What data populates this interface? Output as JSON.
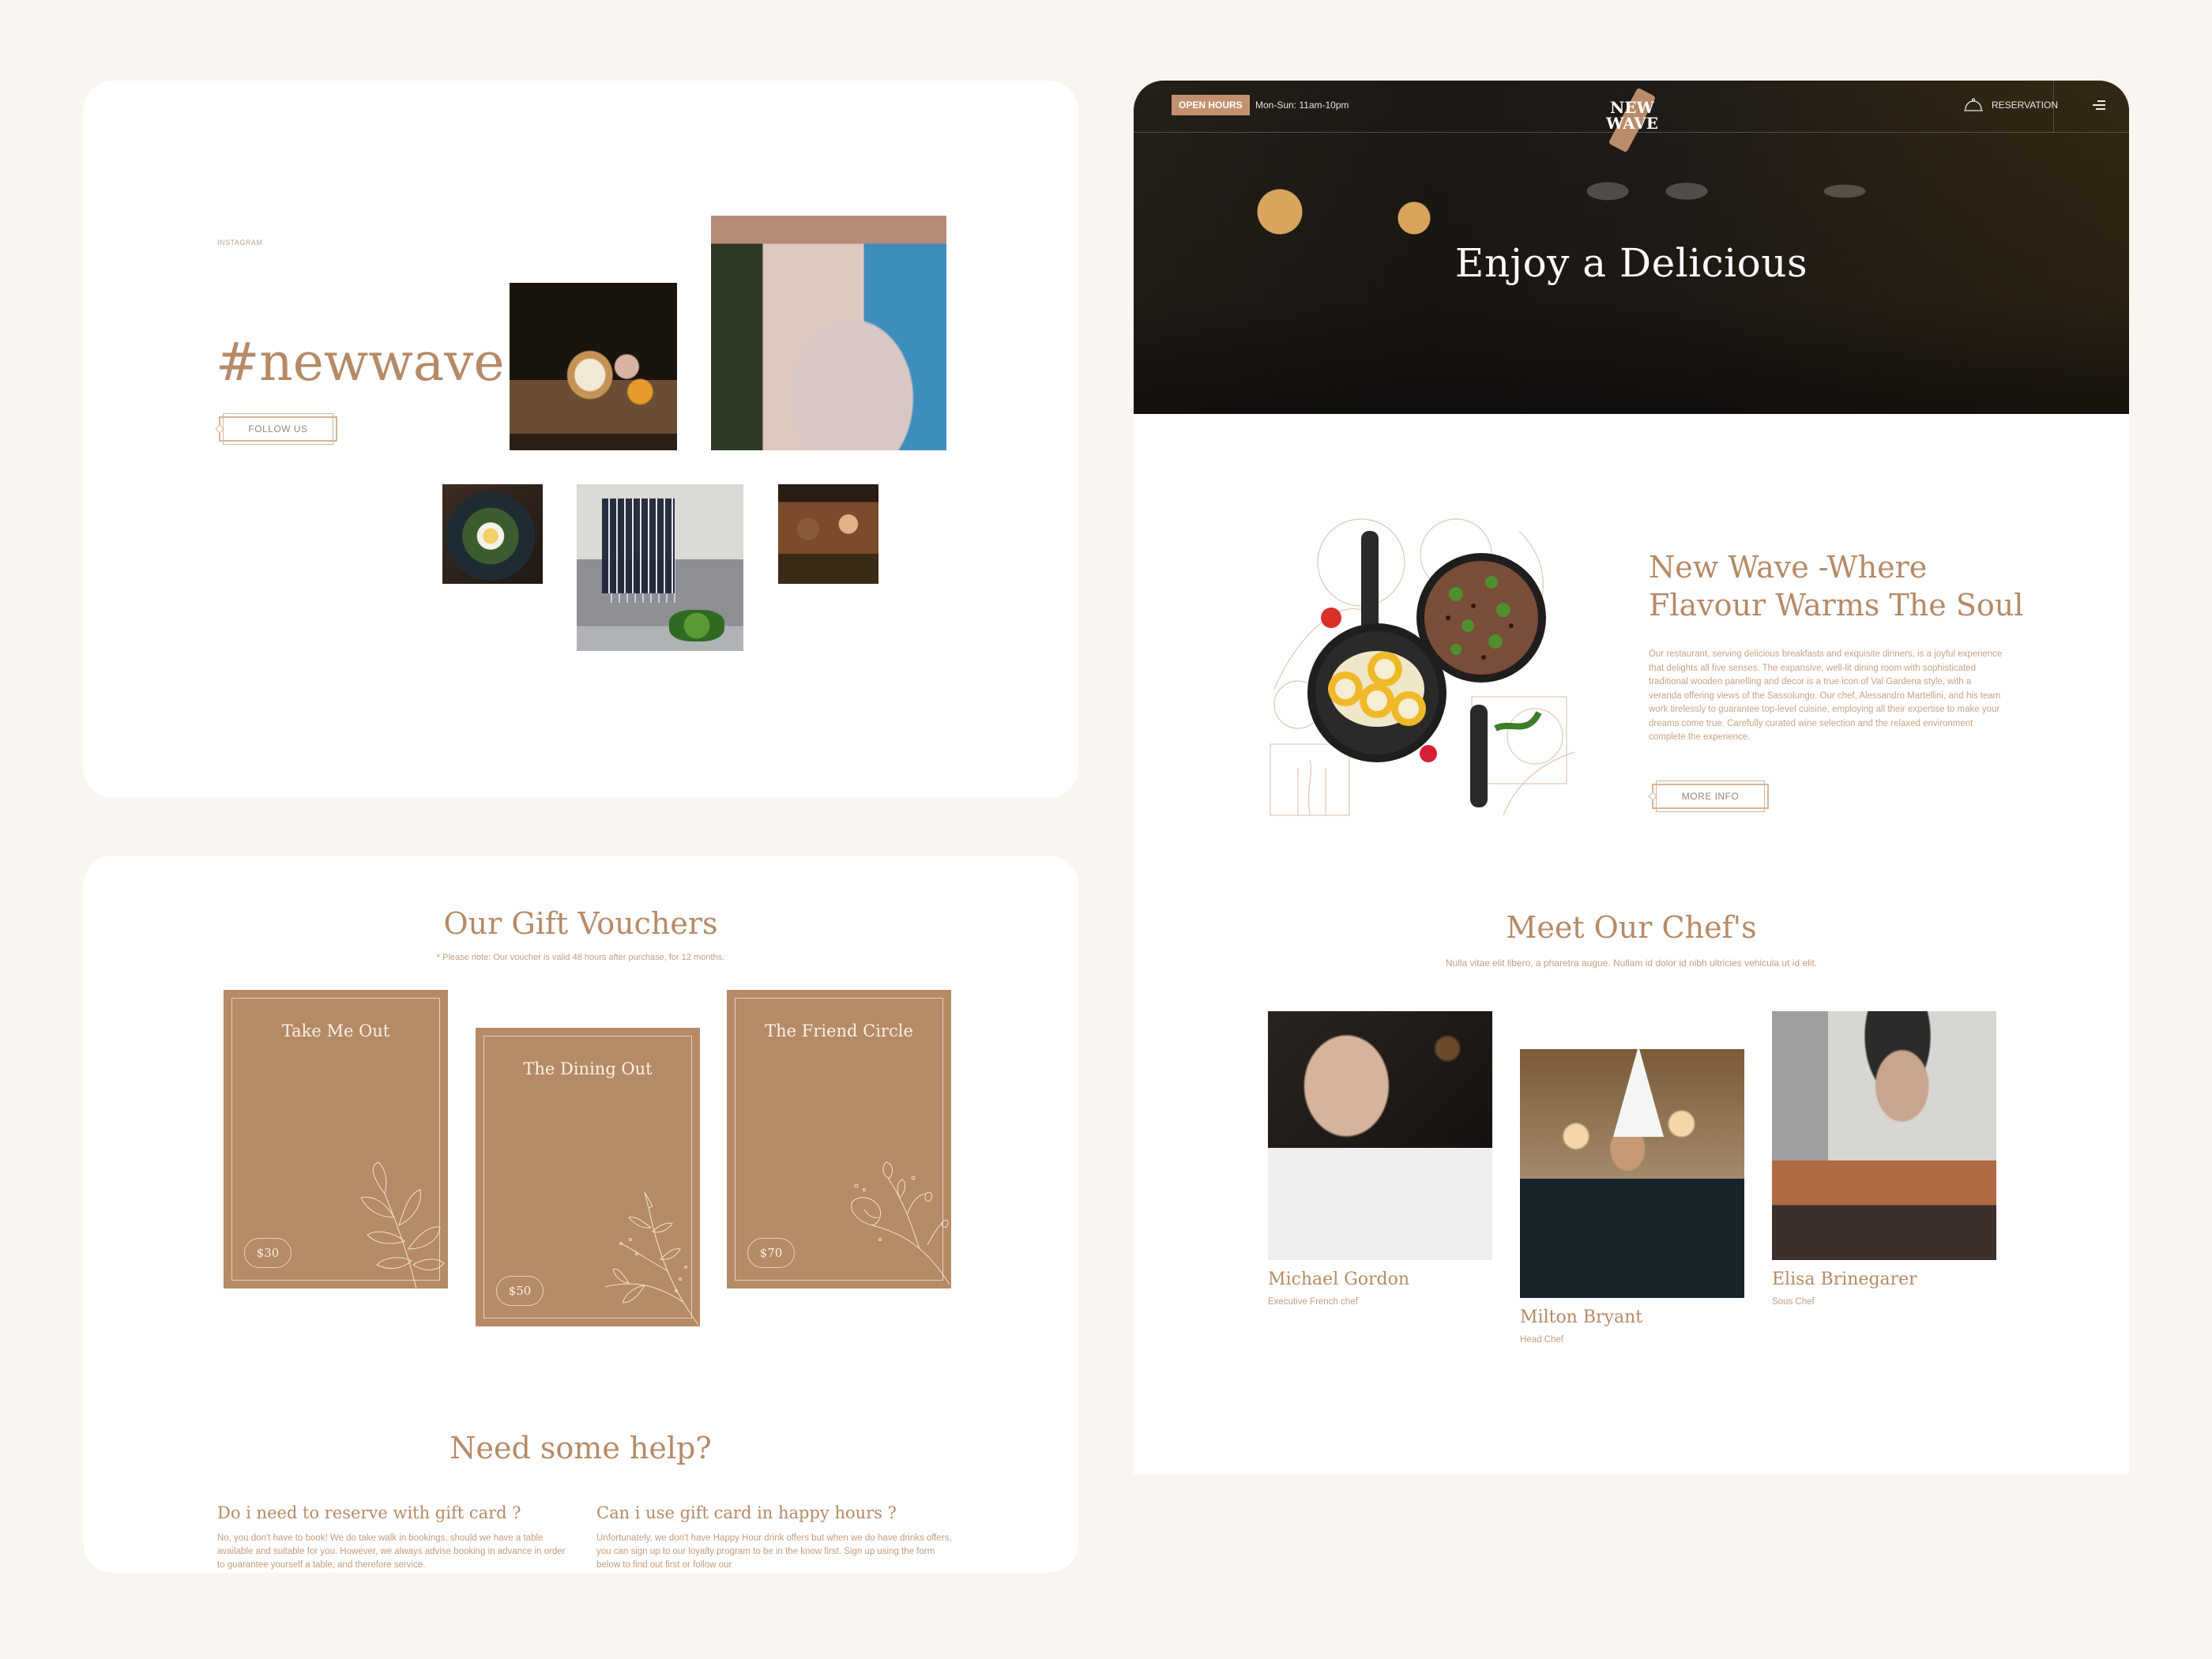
{
  "colors": {
    "page_bg": "#f9f6f1",
    "accent": "#b58a66",
    "accent_badge": "#c39170",
    "card_bg": "#b58a66",
    "card_text": "#fbf1e4"
  },
  "instagram": {
    "label": "INSTAGRAM",
    "hashtag": "#newwave",
    "follow_button": "FOLLOW US",
    "photos": [
      {
        "name": "dessert-photo"
      },
      {
        "name": "terrace-dining-photo"
      },
      {
        "name": "eggs-dish-photo"
      },
      {
        "name": "chef-plating-photo"
      },
      {
        "name": "friends-toasting-photo"
      }
    ]
  },
  "vouchers": {
    "title": "Our Gift Vouchers",
    "note": "* Please note: Our voucher is valid 48 hours after purchase, for 12 months.",
    "cards": [
      {
        "title": "Take Me Out",
        "price": "$30"
      },
      {
        "title": "The Dining Out",
        "price": "$50"
      },
      {
        "title": "The Friend Circle",
        "price": "$70"
      }
    ]
  },
  "help": {
    "title": "Need some help?",
    "faqs": [
      {
        "question": "Do i need to reserve with gift card ?",
        "answer": "No, you don't have to book! We do take walk in bookings, should we have a table available and suitable for you. However, we always advise booking in advance in order to guarantee yourself a table, and therefore service."
      },
      {
        "question": "Can i use gift card in happy hours ?",
        "answer": "Unfortunately, we don't have Happy Hour drink offers but when we do have drinks offers, you can sign up to our loyalty program to be in the know first. Sign up using the form below to find out first or follow our"
      }
    ]
  },
  "home": {
    "nav": {
      "open_badge": "OPEN HOURS",
      "open_hours": "Mon-Sun: 11am-10pm",
      "logo_line1": "NEW",
      "logo_line2": "WAVE",
      "reservation": "RESERVATION",
      "reservation_icon": "cloche-icon",
      "menu_icon": "hamburger-menu-icon"
    },
    "hero_title": "Enjoy a Delicious",
    "about": {
      "title_line1": "New Wave -Where",
      "title_line2": "Flavour Warms The Soul",
      "text": "Our restaurant, serving delicious breakfasts and exquisite dinners, is a joyful experience that delights all five senses. The expansive, well-lit dining room with sophisticated traditional wooden panelling and decor is a true icon of Val Gardena style, with a veranda offering views of the Sassolungo. Our chef, Alessandro Martellini, and his team work tirelessly to guarantee top-level cuisine, employing all their expertise to make your dreams come true. Carefully curated wine selection and the relaxed environment complete the experience.",
      "button": "MORE INFO"
    },
    "chefs": {
      "title": "Meet Our Chef's",
      "subtitle": "Nulla vitae elit libero, a pharetra augue. Nullam id dolor id nibh ultricies vehicula ut id elit.",
      "list": [
        {
          "name": "Michael Gordon",
          "role": "Executive French chef"
        },
        {
          "name": "Milton Bryant",
          "role": "Head Chef"
        },
        {
          "name": "Elisa Brinegarer",
          "role": "Sous Chef"
        }
      ]
    }
  }
}
